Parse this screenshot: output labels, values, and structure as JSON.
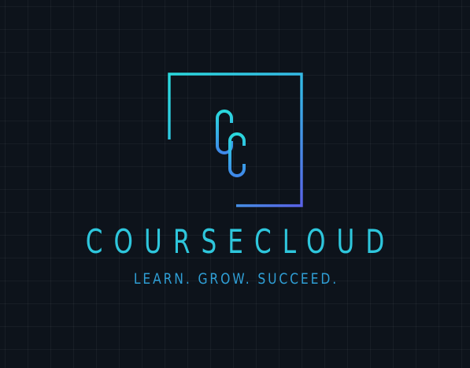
{
  "logo": {
    "monogram": "CC",
    "brand_name": "COURSECLOUD",
    "tagline": "LEARN. GROW. SUCCEED."
  },
  "colors": {
    "background": "#0d131b",
    "gradient_start": "#2ad9dd",
    "gradient_end": "#5a62e8",
    "brand_text": "#2ec6dc",
    "tagline_text": "#2f9fd6"
  },
  "icons": [
    "square-frame-icon",
    "cc-monogram-icon"
  ]
}
